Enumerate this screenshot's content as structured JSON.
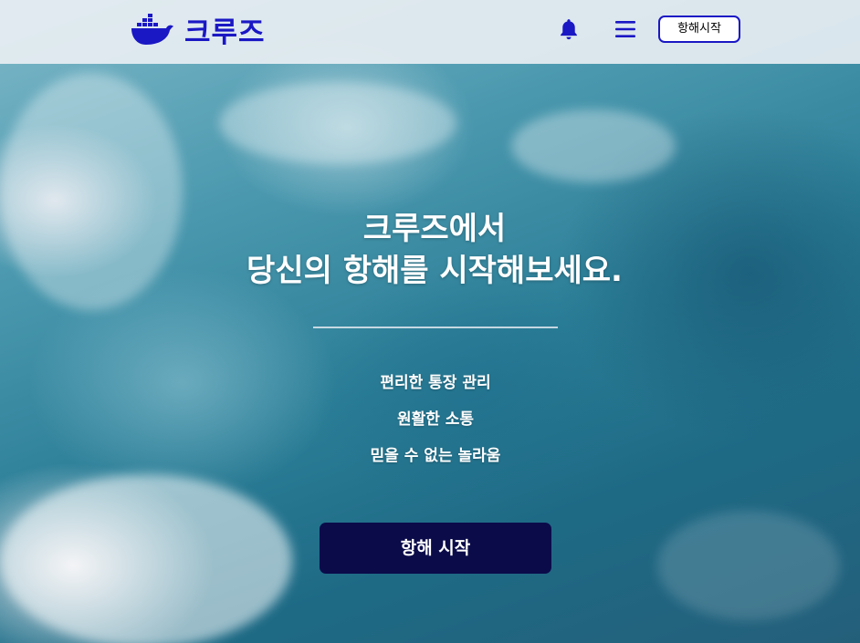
{
  "brand": {
    "name": "크루즈",
    "logo_icon": "whale-icon",
    "color": "#1a17c4"
  },
  "header": {
    "notification_icon": "bell-icon",
    "menu_icon": "hamburger-menu-icon",
    "start_button_label": "항해시작"
  },
  "hero": {
    "title_line1": "크루즈에서",
    "title_line2": "당신의 항해를 시작해보세요.",
    "features": [
      "편리한 통장 관리",
      "원활한 소통",
      "믿을 수 없는 놀라움"
    ],
    "cta_label": "항해 시작",
    "cta_color": "#0b0b4a"
  }
}
